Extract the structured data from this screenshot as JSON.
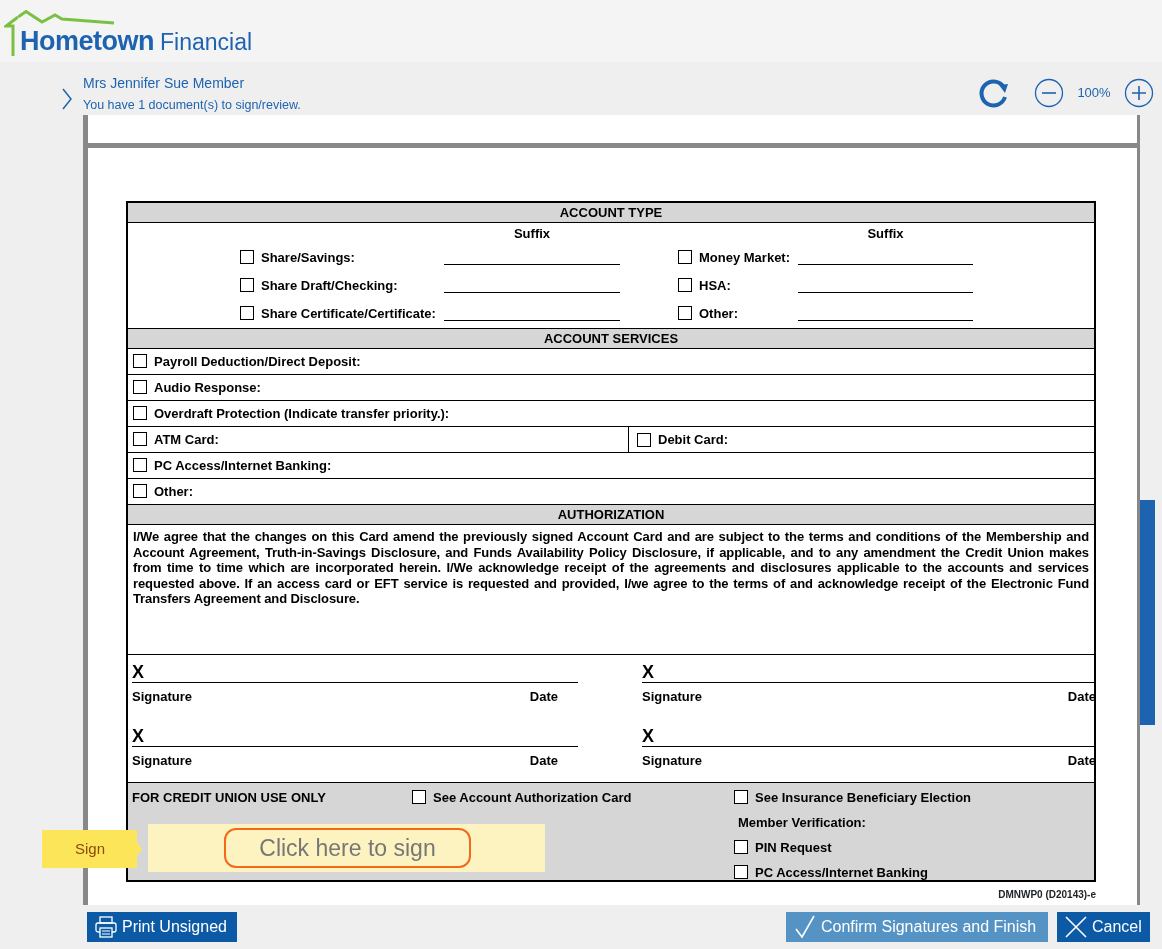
{
  "brand": {
    "name": "Hometown",
    "suffix": "Financial"
  },
  "member": {
    "name": "Mrs Jennifer Sue Member",
    "message": "You have 1 document(s) to sign/review."
  },
  "zoom": {
    "value": "100%"
  },
  "form": {
    "account_type": {
      "title": "ACCOUNT TYPE",
      "suffix_left": "Suffix",
      "suffix_right": "Suffix",
      "rows": [
        {
          "left": {
            "label": "Share/Savings:",
            "checked": false
          },
          "right": {
            "label": "Money Market:",
            "checked": false
          }
        },
        {
          "left": {
            "label": "Share Draft/Checking:",
            "checked": false
          },
          "right": {
            "label": "HSA:",
            "checked": false
          }
        },
        {
          "left": {
            "label": "Share Certificate/Certificate:",
            "checked": false
          },
          "right": {
            "label": "Other:",
            "checked": false
          }
        }
      ]
    },
    "account_services": {
      "title": "ACCOUNT SERVICES",
      "rows": [
        [
          {
            "label": "Payroll Deduction/Direct Deposit:",
            "checked": false
          }
        ],
        [
          {
            "label": "Audio Response:",
            "checked": false
          }
        ],
        [
          {
            "label": "Overdraft Protection (Indicate transfer priority.):",
            "checked": false
          }
        ],
        [
          {
            "label": "ATM Card:",
            "checked": false
          },
          {
            "label": "Debit Card:",
            "checked": false
          }
        ],
        [
          {
            "label": "PC Access/Internet Banking:",
            "checked": false
          }
        ],
        [
          {
            "label": "Other:",
            "checked": false
          }
        ]
      ]
    },
    "authorization": {
      "title": "AUTHORIZATION",
      "text": "I/We agree that the changes on this Card amend the previously signed Account Card and are subject to the terms and conditions of the Membership and Account Agreement, Truth-in-Savings Disclosure, and Funds Availability Policy Disclosure, if applicable, and to any amendment the Credit Union makes from time to time which are incorporated herein. I/We acknowledge receipt of the agreements and disclosures applicable to the accounts and services requested above. If an access card or EFT service is requested and provided, I/we agree to the terms of and acknowledge receipt of the Electronic Fund Transfers Agreement and Disclosure."
    },
    "signatures": [
      {
        "mark": "X",
        "signature_label": "Signature",
        "date_label": "Date"
      },
      {
        "mark": "X",
        "signature_label": "Signature",
        "date_label": "Date"
      },
      {
        "mark": "X",
        "signature_label": "Signature",
        "date_label": "Date"
      },
      {
        "mark": "X",
        "signature_label": "Signature",
        "date_label": "Date"
      }
    ],
    "office_use": {
      "title": "FOR CREDIT UNION USE ONLY",
      "middle": [
        {
          "kind": "checkbox",
          "label": "See Account Authorization Card",
          "checked": false
        }
      ],
      "right": [
        {
          "kind": "checkbox",
          "label": "See Insurance Beneficiary Election",
          "checked": false
        },
        {
          "kind": "heading",
          "label": "Member Verification:"
        },
        {
          "kind": "checkbox",
          "label": "PIN Request",
          "checked": false
        },
        {
          "kind": "checkbox",
          "label": "PC Access/Internet Banking",
          "checked": false
        }
      ]
    },
    "form_code": "DMNWP0 (D20143)-e"
  },
  "sign_tag": {
    "label": "Sign",
    "button": "Click here to sign"
  },
  "footer": {
    "print": "Print Unsigned",
    "confirm": "Confirm Signatures and Finish",
    "cancel": "Cancel"
  }
}
